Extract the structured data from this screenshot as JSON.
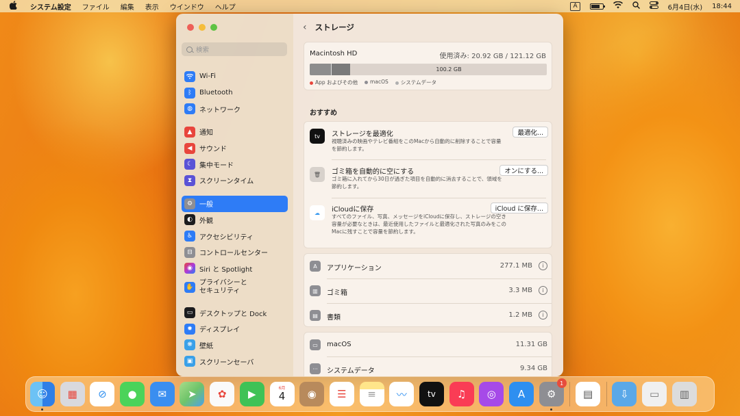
{
  "menubar": {
    "apple": "",
    "app_name": "システム設定",
    "items": [
      "ファイル",
      "編集",
      "表示",
      "ウインドウ",
      "ヘルプ"
    ],
    "input_indicator": "A",
    "date": "6月4日(水)",
    "time": "18:44"
  },
  "window": {
    "search_placeholder": "検索",
    "sidebar": {
      "items": [
        {
          "label": "Wi-Fi",
          "icon": "wifi-icon",
          "color": "#2e7cf6"
        },
        {
          "label": "Bluetooth",
          "icon": "bluetooth-icon",
          "color": "#2e7cf6"
        },
        {
          "label": "ネットワーク",
          "icon": "globe-icon",
          "color": "#2e7cf6"
        },
        {
          "label": "通知",
          "icon": "bell-icon",
          "color": "#e8453c"
        },
        {
          "label": "サウンド",
          "icon": "speaker-icon",
          "color": "#e8453c"
        },
        {
          "label": "集中モード",
          "icon": "moon-icon",
          "color": "#5a52d6"
        },
        {
          "label": "スクリーンタイム",
          "icon": "hourglass-icon",
          "color": "#5a52d6"
        },
        {
          "label": "一般",
          "icon": "gear-icon",
          "color": "#8e8e93"
        },
        {
          "label": "外観",
          "icon": "appearance-icon",
          "color": "#1c1c1e"
        },
        {
          "label": "アクセシビリティ",
          "icon": "accessibility-icon",
          "color": "#2e7cf6"
        },
        {
          "label": "コントロールセンター",
          "icon": "control-center-icon",
          "color": "#8e8e93"
        },
        {
          "label": "Siri と Spotlight",
          "icon": "siri-icon",
          "color": "#b03ad6"
        },
        {
          "label_line1": "プライバシーと",
          "label_line2": "セキュリティ",
          "icon": "hand-icon",
          "color": "#2e7cf6"
        },
        {
          "label": "デスクトップと Dock",
          "icon": "dock-icon",
          "color": "#1c1c1e"
        },
        {
          "label": "ディスプレイ",
          "icon": "display-icon",
          "color": "#2e7cf6"
        },
        {
          "label": "壁紙",
          "icon": "wallpaper-icon",
          "color": "#3aa0e8"
        },
        {
          "label": "スクリーンセーバ",
          "icon": "screensaver-icon",
          "color": "#3aa0e8"
        }
      ]
    },
    "main": {
      "back": "‹",
      "title": "ストレージ",
      "disk": {
        "name": "Macintosh HD",
        "used": "使用済み: 20.92 GB / 121.12 GB",
        "free_label": "100.2 GB",
        "legend": [
          {
            "label": "App およびその他",
            "color": "#e8453c"
          },
          {
            "label": "macOS",
            "color": "#8e8e93"
          },
          {
            "label": "システムデータ",
            "color": "#b0b0b0"
          }
        ]
      },
      "recommend_label": "おすすめ",
      "recommendations": [
        {
          "title": "ストレージを最適化",
          "desc": "視聴済みの映画やテレビ番組をこのMacから自動的に削除することで容量を節約します。",
          "button": "最適化...",
          "icon": "tv-icon"
        },
        {
          "title": "ゴミ箱を自動的に空にする",
          "desc": "ゴミ箱に入れてから30日が過ぎた項目を自動的に消去することで、領域を節約します。",
          "button": "オンにする...",
          "icon": "trash-icon"
        },
        {
          "title": "iCloudに保存",
          "desc": "すべてのファイル、写真、メッセージをiCloudに保存し、ストレージの空き容量が必要なときは、最近使用したファイルと最適化された写真のみをこのMacに残すことで容量を節約します。",
          "button": "iCloud に保存...",
          "icon": "cloud-icon"
        }
      ],
      "categories": [
        {
          "name": "アプリケーション",
          "size": "277.1 MB",
          "icon": "applications-icon"
        },
        {
          "name": "ゴミ箱",
          "size": "3.3 MB",
          "icon": "trash-icon"
        },
        {
          "name": "書類",
          "size": "1.2 MB",
          "icon": "document-icon"
        }
      ],
      "system_categories": [
        {
          "name": "macOS",
          "size": "11.31 GB",
          "icon": "macos-icon"
        },
        {
          "name": "システムデータ",
          "size": "9.34 GB",
          "icon": "system-data-icon"
        }
      ]
    }
  },
  "dock": {
    "apps": [
      {
        "name": "finder",
        "color": "#3a9bf0",
        "glyph": "☺"
      },
      {
        "name": "launchpad",
        "color": "#d6d6dc",
        "glyph": "▦"
      },
      {
        "name": "safari",
        "color": "#2e8ff0",
        "glyph": "⊘"
      },
      {
        "name": "messages",
        "color": "#4bd35a",
        "glyph": "💬"
      },
      {
        "name": "mail",
        "color": "#3a8ef0",
        "glyph": "✉"
      },
      {
        "name": "maps",
        "color": "#6fc46a",
        "glyph": "➤"
      },
      {
        "name": "photos",
        "color": "#f4f4f4",
        "glyph": "✿"
      },
      {
        "name": "facetime",
        "color": "#3fc256",
        "glyph": "▶"
      },
      {
        "name": "calendar",
        "color": "#ffffff",
        "glyph": "4",
        "month": "6月"
      },
      {
        "name": "contacts",
        "color": "#b88a5c",
        "glyph": "●"
      },
      {
        "name": "reminders",
        "color": "#ffffff",
        "glyph": "☰"
      },
      {
        "name": "notes",
        "color": "#ffe58a",
        "glyph": "≡"
      },
      {
        "name": "freeform",
        "color": "#ffffff",
        "glyph": "〰"
      },
      {
        "name": "tv",
        "color": "#111111",
        "glyph": "tv"
      },
      {
        "name": "music",
        "color": "#fa3c55",
        "glyph": "♫"
      },
      {
        "name": "podcasts",
        "color": "#a64ae8",
        "glyph": "◉"
      },
      {
        "name": "app-store",
        "color": "#2e8ff0",
        "glyph": "A"
      },
      {
        "name": "system-settings",
        "color": "#8e8e93",
        "glyph": "⚙",
        "badge": "1"
      },
      {
        "name": "preview",
        "color": "#ffffff",
        "glyph": "▤"
      },
      {
        "name": "downloads",
        "color": "#5aa8e8",
        "glyph": "⇩"
      },
      {
        "name": "drive",
        "color": "#f0f0f0",
        "glyph": "▭"
      },
      {
        "name": "trash",
        "color": "#dcdcdc",
        "glyph": "🗑"
      }
    ]
  }
}
